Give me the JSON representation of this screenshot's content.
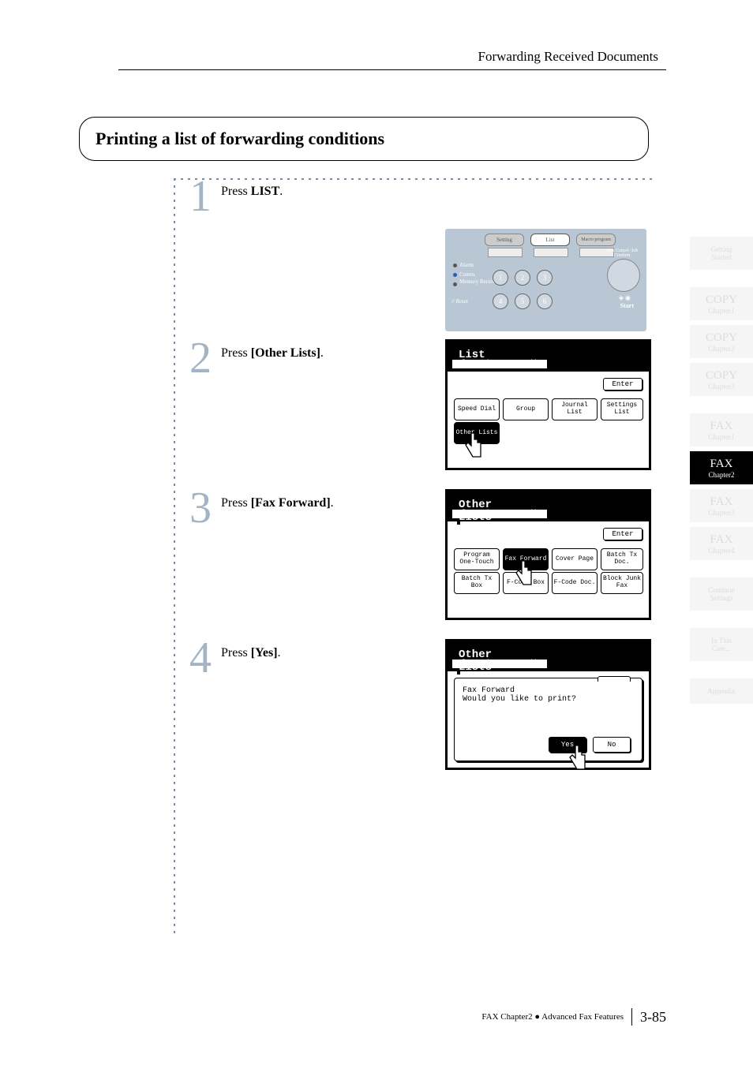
{
  "header": "Forwarding Received Documents",
  "section_title": "Printing a list of forwarding conditions",
  "steps": {
    "s1": {
      "num": "1",
      "prefix": "Press ",
      "bold": "LIST",
      "suffix": "."
    },
    "s2": {
      "num": "2",
      "prefix": "Press ",
      "bold": "[Other Lists]",
      "suffix": "."
    },
    "s3": {
      "num": "3",
      "prefix": "Press ",
      "bold": "[Fax Forward]",
      "suffix": "."
    },
    "s4": {
      "num": "4",
      "prefix": "Press ",
      "bold": "[Yes]",
      "suffix": "."
    }
  },
  "panel": {
    "btn_setting": "Setting",
    "btn_list": "List",
    "btn_macro": "Macro\nprogram",
    "lbl_alarm": "Alarm",
    "lbl_comm": "Comm.",
    "lbl_memory": "Memory\nReceive",
    "lbl_reset": "// Reset",
    "lbl_cancel": "Fax Cancel\n/Job Confirm.",
    "lbl_start": "Start",
    "k1": "1",
    "k2": "2",
    "k3": "3",
    "k4": "4",
    "k5": "5",
    "k6": "6"
  },
  "lcd2": {
    "title": "List",
    "sub": "Select item to edit.",
    "enter": "Enter",
    "b1": "Speed Dial",
    "b2": "Group",
    "b3": "Journal\nList",
    "b4": "Settings\nList",
    "b5": "Other\nLists"
  },
  "lcd3": {
    "title": "Other Lists",
    "sub": "Select item to edit.",
    "enter": "Enter",
    "b1": "Program\nOne-Touch",
    "b2": "Fax\nForward",
    "b3": "Cover Page",
    "b4": "Batch Tx\nDoc.",
    "b5": "Batch Tx\nBox",
    "b6": "F-Code Box",
    "b7": "F-Code\nDoc.",
    "b8": "Block Junk\nFax"
  },
  "lcd4": {
    "title": "Other Lists",
    "sub": "Select item to edit.",
    "dlg_line1": "Fax Forward",
    "dlg_line2": "Would you like to print?",
    "yes": "Yes",
    "no": "No"
  },
  "tabs": {
    "t1a": "Getting",
    "t1b": "Started",
    "t2a": "COPY",
    "t2b": "Chapter1",
    "t3a": "COPY",
    "t3b": "Chapter2",
    "t4a": "COPY",
    "t4b": "Chapter3",
    "t5a": "FAX",
    "t5b": "Chapter1",
    "t6a": "FAX",
    "t6b": "Chapter2",
    "t7a": "FAX",
    "t7b": "Chapter3",
    "t8a": "FAX",
    "t8b": "Chapter4",
    "t9a": "Common",
    "t9b": "Settings",
    "t10a": "In This",
    "t10b": "Case...",
    "t11a": "Appendix"
  },
  "footer": {
    "text": "FAX Chapter2 ● Advanced Fax Features",
    "page": "3-85"
  }
}
